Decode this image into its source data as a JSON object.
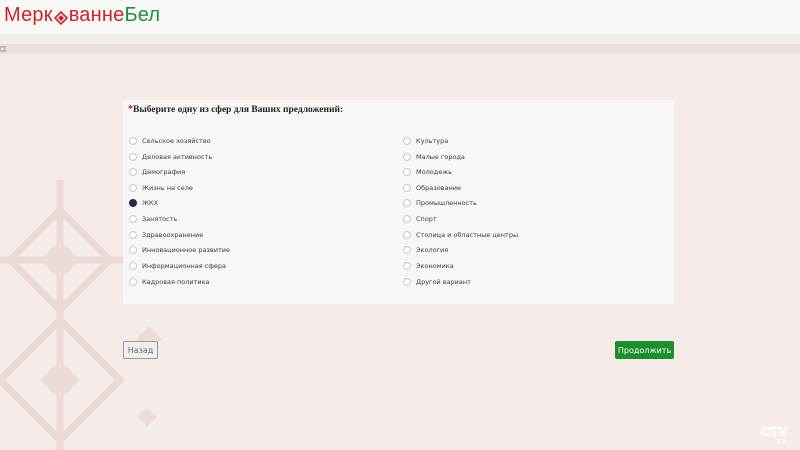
{
  "header": {
    "logo_part1": "Мерк",
    "logo_part2": "ванне",
    "logo_part3": "Бел",
    "colors": {
      "red": "#d42027",
      "green": "#1d8f3b"
    }
  },
  "form": {
    "required_mark": "*",
    "question": "Выберите одну из сфер для Ваших предложений:",
    "options_left": [
      {
        "label": "Сельское хозяйство",
        "checked": false
      },
      {
        "label": "Деловая активность",
        "checked": false
      },
      {
        "label": "Демография",
        "checked": false
      },
      {
        "label": "Жизнь на селе",
        "checked": false
      },
      {
        "label": "ЖКХ",
        "checked": true
      },
      {
        "label": "Занятость",
        "checked": false
      },
      {
        "label": "Здравоохранение",
        "checked": false
      },
      {
        "label": "Инновационное развитие",
        "checked": false
      },
      {
        "label": "Информационная сфера",
        "checked": false
      },
      {
        "label": "Кадровая политика",
        "checked": false
      }
    ],
    "options_right": [
      {
        "label": "Культура",
        "checked": false
      },
      {
        "label": "Малые города",
        "checked": false
      },
      {
        "label": "Молодежь",
        "checked": false
      },
      {
        "label": "Образование",
        "checked": false
      },
      {
        "label": "Промышленность",
        "checked": false
      },
      {
        "label": "Спорт",
        "checked": false
      },
      {
        "label": "Столица и областные центры",
        "checked": false
      },
      {
        "label": "Экология",
        "checked": false
      },
      {
        "label": "Экономика",
        "checked": false
      },
      {
        "label": "Другой вариант",
        "checked": false
      }
    ]
  },
  "buttons": {
    "back_label": "Назад",
    "next_label": "Продолжить",
    "next_color": "#1c8e2e"
  },
  "watermark": {
    "text": "CTV",
    "sub": ".BY"
  }
}
